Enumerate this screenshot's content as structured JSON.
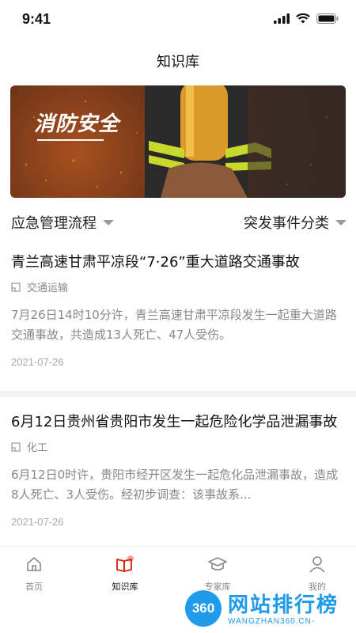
{
  "status": {
    "time": "9:41"
  },
  "nav": {
    "title": "知识库"
  },
  "banner": {
    "text": "消防安全"
  },
  "filters": {
    "left": "应急管理流程",
    "right": "突发事件分类"
  },
  "articles": [
    {
      "title": "青兰高速甘肃平凉段“7·26”重大道路交通事故",
      "tag": "交通运输",
      "desc": "7月26日14时10分许，青兰高速甘肃平凉段发生一起重大道路交通事故，共造成13人死亡、47人受伤。",
      "date": "2021-07-26"
    },
    {
      "title": "6月12日贵州省贵阳市发生一起危险化学品泄漏事故",
      "tag": "化工",
      "desc": "6月12日0时许，贵阳市经开区发生一起危化品泄漏事故，造成8人死亡、3人受伤。经初步调查：该事故系...",
      "date": "2021-07-26"
    }
  ],
  "tabs": [
    {
      "label": "首页",
      "icon": "home-icon"
    },
    {
      "label": "知识库",
      "icon": "book-icon"
    },
    {
      "label": "专家库",
      "icon": "graduation-cap-icon"
    },
    {
      "label": "我的",
      "icon": "user-icon"
    }
  ],
  "watermark": {
    "title": "网站排行榜",
    "circle": "360",
    "sub": "WANGZHAN360.CN-"
  },
  "colors": {
    "accent": "#d81e06",
    "watermark": "#1e9be9"
  }
}
